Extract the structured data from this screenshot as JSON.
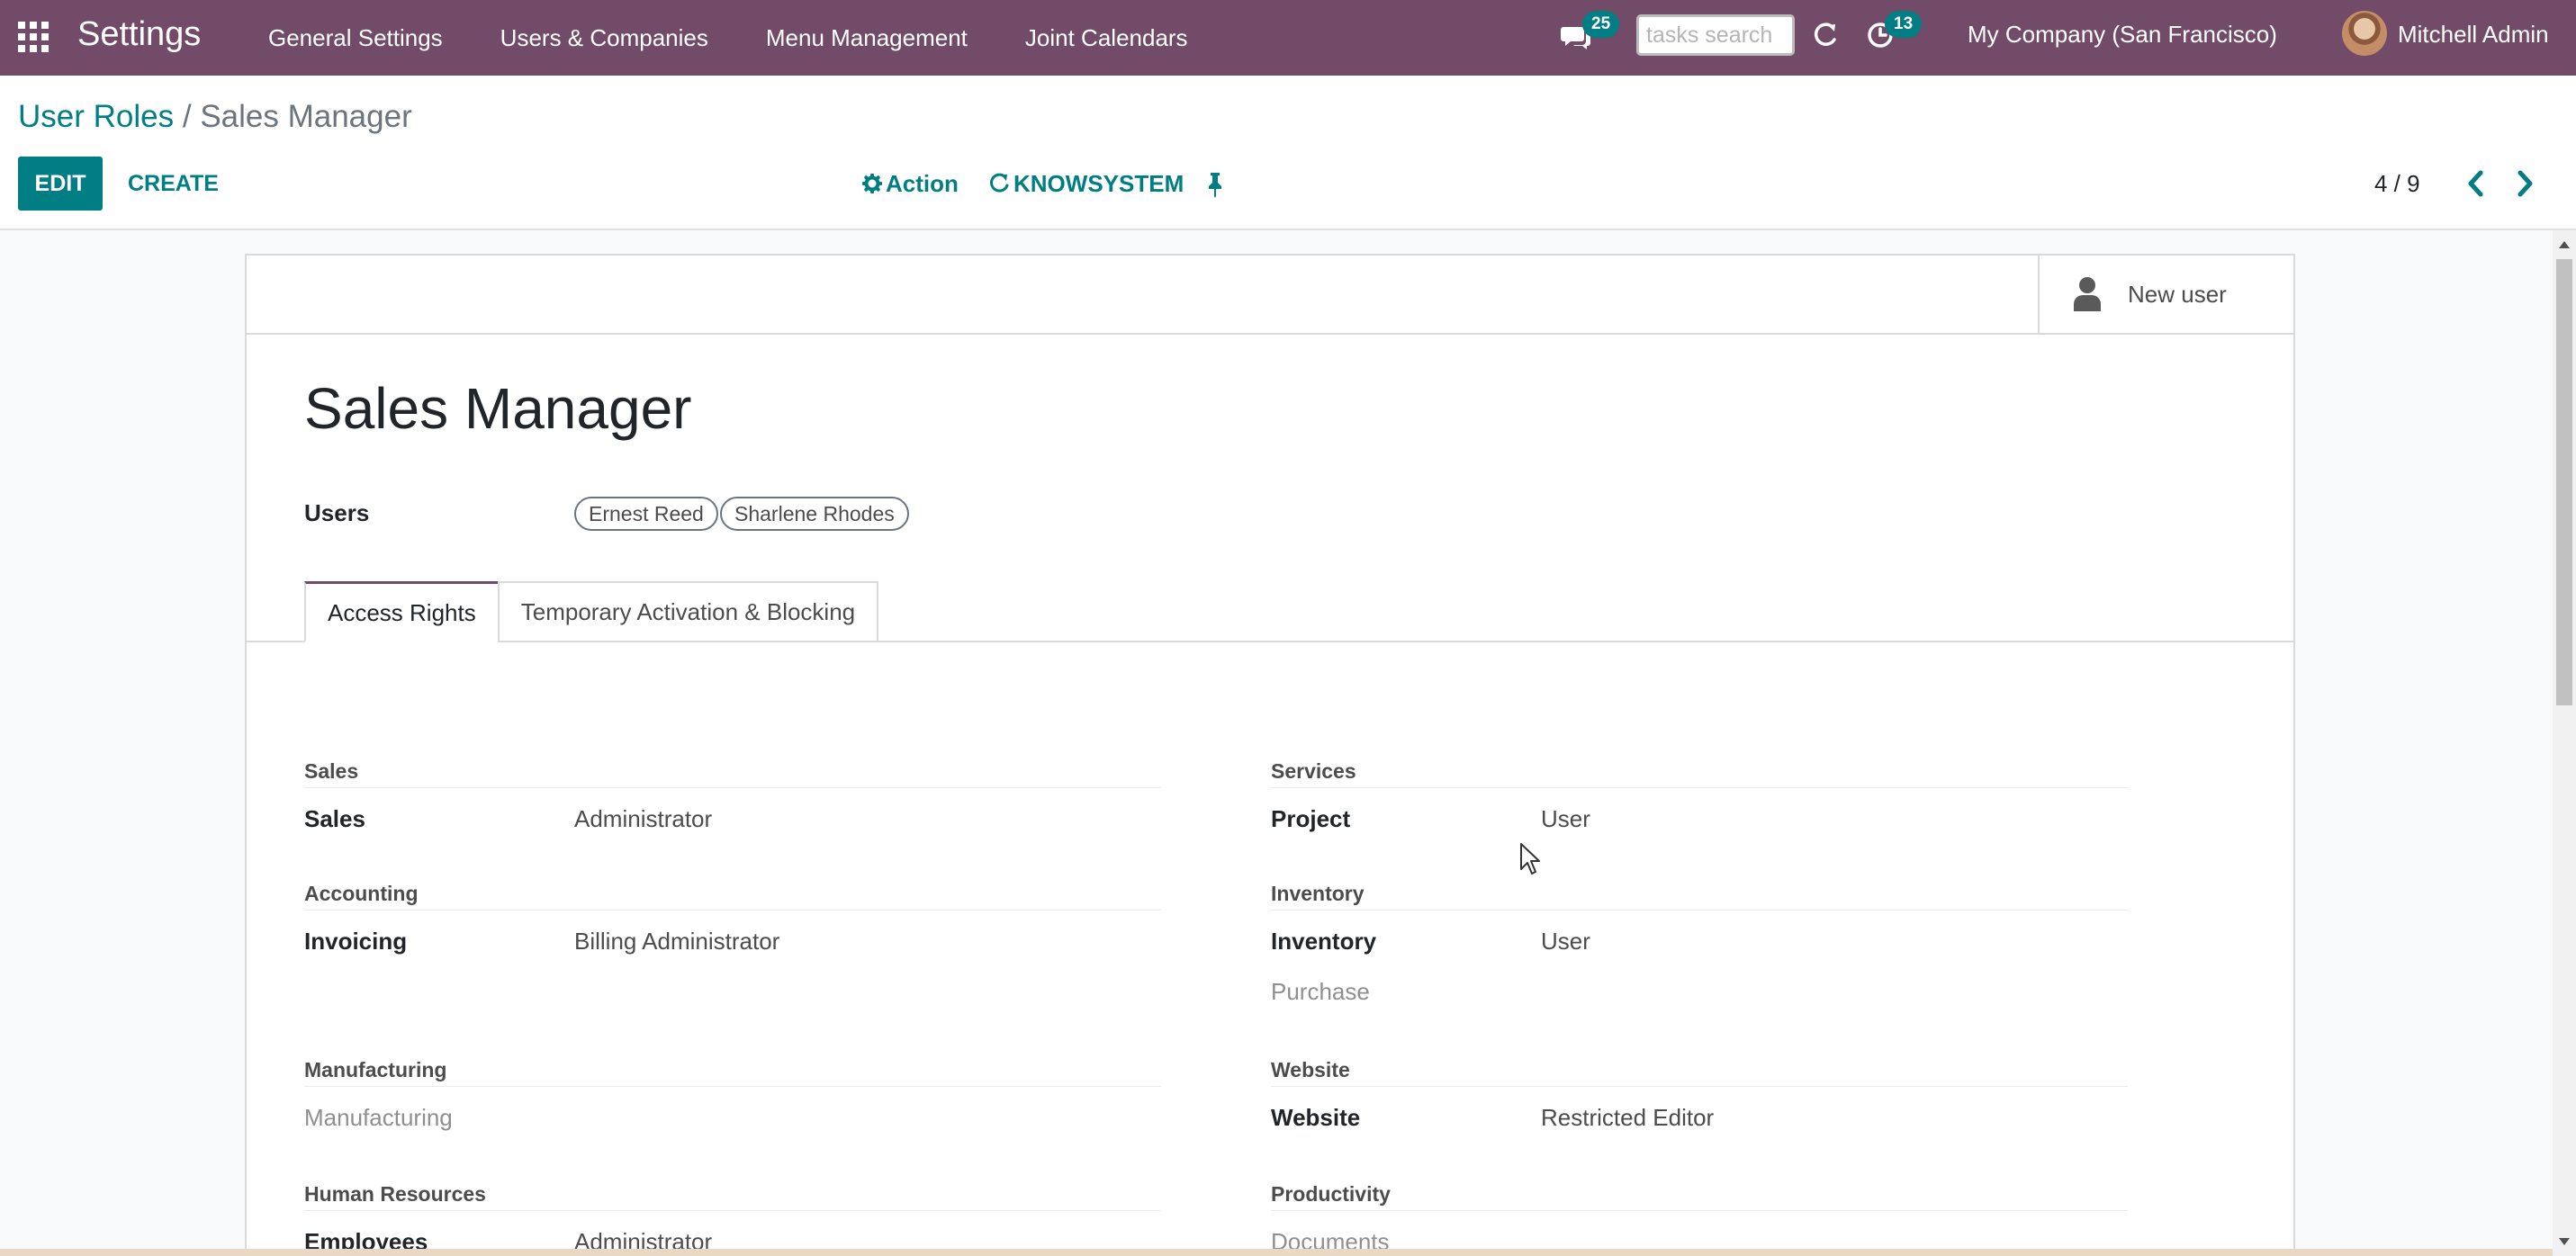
{
  "navbar": {
    "app_name": "Settings",
    "menu": [
      "General Settings",
      "Users & Companies",
      "Menu Management",
      "Joint Calendars"
    ],
    "chat_count": "25",
    "search_placeholder": "tasks search",
    "activity_count": "13",
    "company": "My Company (San Francisco)",
    "user": "Mitchell Admin",
    "bg_color": "#714b67"
  },
  "breadcrumb": {
    "parent": "User Roles",
    "separator": "/",
    "current": "Sales Manager"
  },
  "toolbar": {
    "edit_label": "EDIT",
    "create_label": "CREATE",
    "action_label": "Action",
    "knowsystem_label": "KNOWSYSTEM",
    "pager": "4 / 9"
  },
  "button_box": {
    "new_user_label": "New user"
  },
  "record": {
    "title": "Sales Manager",
    "users_label": "Users",
    "users": [
      "Ernest Reed",
      "Sharlene Rhodes"
    ]
  },
  "tabs": [
    "Access Rights",
    "Temporary Activation & Blocking"
  ],
  "access_rights": {
    "left": [
      {
        "group": "Sales",
        "fields": [
          {
            "label": "Sales",
            "value": "Administrator",
            "muted": false
          }
        ]
      },
      {
        "group": "Accounting",
        "fields": [
          {
            "label": "Invoicing",
            "value": "Billing Administrator",
            "muted": false
          }
        ]
      },
      {
        "group": "Manufacturing",
        "fields": [
          {
            "label": "Manufacturing",
            "value": "",
            "muted": true
          }
        ]
      },
      {
        "group": "Human Resources",
        "fields": [
          {
            "label": "Employees",
            "value": "Administrator",
            "muted": false
          }
        ]
      }
    ],
    "right": [
      {
        "group": "Services",
        "fields": [
          {
            "label": "Project",
            "value": "User",
            "muted": false
          }
        ]
      },
      {
        "group": "Inventory",
        "fields": [
          {
            "label": "Inventory",
            "value": "User",
            "muted": false
          },
          {
            "label": "Purchase",
            "value": "",
            "muted": true
          }
        ]
      },
      {
        "group": "Website",
        "fields": [
          {
            "label": "Website",
            "value": "Restricted Editor",
            "muted": false
          }
        ]
      },
      {
        "group": "Productivity",
        "fields": [
          {
            "label": "Documents",
            "value": "",
            "muted": true
          }
        ]
      }
    ]
  },
  "colors": {
    "primary": "#017e84",
    "brand": "#714b67"
  }
}
